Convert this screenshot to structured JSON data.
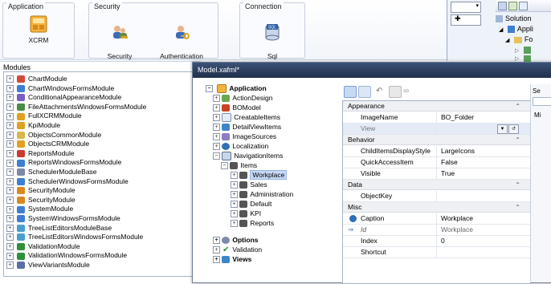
{
  "ribbon": {
    "application_group": "Application",
    "security_group": "Security",
    "connection_group": "Connection",
    "xcrm_label": "XCRM",
    "security_complex_label": "Security\nComplex",
    "auth_standard_label": "Authentication\nStandard",
    "sql_connection_label": "Sql\nConnection",
    "sql_badge": "SQL"
  },
  "solution_explorer": {
    "title": "Solution",
    "item1": "Appli",
    "item2": "Fo"
  },
  "modules": {
    "title": "Modules",
    "items": [
      "ChartModule",
      "ChartWindowsFormsModule",
      "ConditionalAppearanceModule",
      "FileAttachmentsWindowsFormsModule",
      "FullXCRMModule",
      "KpiModule",
      "ObjectsCommonModule",
      "ObjectsCRMModule",
      "ReportsModule",
      "ReportsWindowsFormsModule",
      "SchedulerModuleBase",
      "SchedulerWindowsFormsModule",
      "SecurityModule",
      "SecurityModule",
      "SystemModule",
      "SystemWindowsFormsModule",
      "TreeListEditorsModuleBase",
      "TreeListEditorsWindowsFormsModule",
      "ValidationModule",
      "ValidationWindowsFormsModule",
      "ViewVariantsModule"
    ],
    "icon_colors": [
      "#d44a3a",
      "#3f7fd1",
      "#7a5fc2",
      "#4c8c46",
      "#e0a020",
      "#e0a020",
      "#d8b84a",
      "#e0a020",
      "#c93c2f",
      "#3f7fd1",
      "#7a8aa8",
      "#3f7fd1",
      "#d88a20",
      "#d88a20",
      "#3f7fd1",
      "#3f7fd1",
      "#4aa0c8",
      "#4aa0c8",
      "#2f8f3a",
      "#2f8f3a",
      "#5a6fa6"
    ]
  },
  "model": {
    "title": "Model.xafml*",
    "tree": {
      "application": "Application",
      "action_design": "ActionDesign",
      "bo_model": "BOModel",
      "creatable_items": "CreatableItems",
      "detail_view_items": "DetailViewItems",
      "image_sources": "ImageSources",
      "localization": "Localization",
      "navigation_items": "NavigationItems",
      "items": "Items",
      "workplace": "Workplace",
      "sales": "Sales",
      "administration": "Administration",
      "default": "Default",
      "kpi": "KPI",
      "reports": "Reports",
      "options": "Options",
      "validation": "Validation",
      "views": "Views"
    },
    "props": {
      "appearance": "Appearance",
      "image_name_label": "ImageName",
      "image_name_value": "BO_Folder",
      "view_label": "View",
      "behavior": "Behavior",
      "child_style_label": "ChildItemsDisplayStyle",
      "child_style_value": "LargeIcons",
      "quick_access_label": "QuickAccessItem",
      "quick_access_value": "False",
      "visible_label": "Visible",
      "visible_value": "True",
      "data": "Data",
      "object_key_label": "ObjectKey",
      "misc": "Misc",
      "caption_label": "Caption",
      "caption_value": "Workplace",
      "id_label": "Id",
      "id_value": "Workplace",
      "index_label": "Index",
      "index_value": "0",
      "shortcut_label": "Shortcut"
    },
    "right_side": {
      "se": "Se",
      "m": "Mi"
    }
  },
  "colors": {
    "title_bar": "#2a3d5e",
    "selection": "#c7d9f5",
    "category": "#eef0f3"
  }
}
